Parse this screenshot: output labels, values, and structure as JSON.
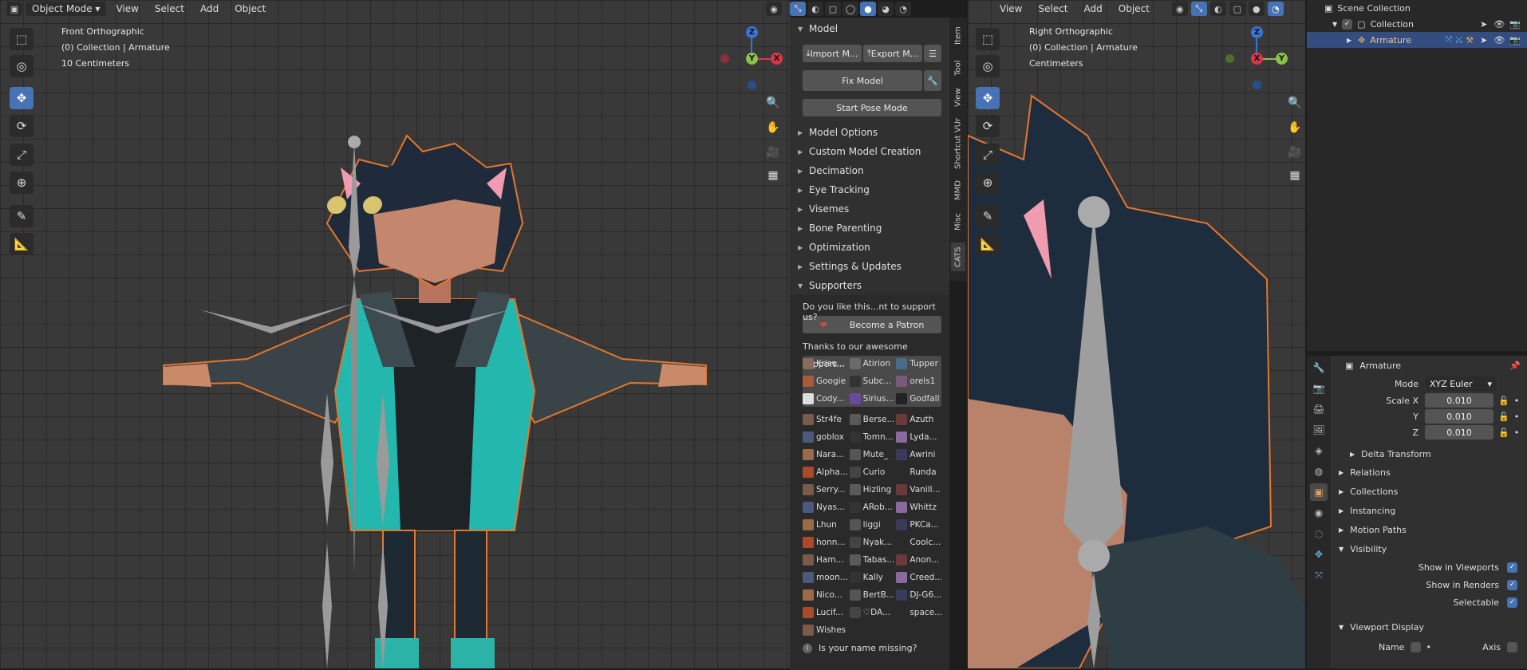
{
  "left_viewport": {
    "header": {
      "mode": "Object Mode",
      "menus": [
        "View",
        "Select",
        "Add",
        "Object"
      ]
    },
    "overlay": {
      "view": "Front Orthographic",
      "collection": "(0) Collection | Armature",
      "scale": "10 Centimeters"
    },
    "gizmo": {
      "z": "Z",
      "y": "Y",
      "x": "X"
    }
  },
  "npanel": {
    "model_header": "Model",
    "import_label": "Import M...",
    "export_label": "Export M...",
    "fix_model": "Fix Model",
    "start_pose": "Start Pose Mode",
    "sections": [
      "Model Options",
      "Custom Model Creation",
      "Decimation",
      "Eye Tracking",
      "Visemes",
      "Bone Parenting",
      "Optimization",
      "Settings & Updates"
    ],
    "supporters_header": "Supporters",
    "support_question": "Do you like this...nt to support us?",
    "patron_label": "Become a Patron",
    "thanks_text": "Thanks to our awesome support...",
    "top_supporters": [
      "Krisu...",
      "Atirion",
      "Tupper",
      "Googie",
      "Subc...",
      "orels1",
      "Cody...",
      "Sirius...",
      "Godfall"
    ],
    "supporters": [
      "Str4fe",
      "Berse...",
      "Azuth",
      "goblox",
      "Tomn...",
      "Lyda...",
      "Nara...",
      "Mute_",
      "Awrini",
      "Alpha...",
      "Curio",
      "Runda",
      "Serry...",
      "Hizling",
      "Vanill...",
      "Nyas...",
      "ARob...",
      "Whittz",
      "Lhun",
      "liggi",
      "PKCa...",
      "honn...",
      "Nyak...",
      "Coolc...",
      "Ham...",
      "Tabas...",
      "Anon...",
      "moon...",
      "Kally",
      "Creed...",
      "Nico...",
      "BertB...",
      "DJ-G6...",
      "Lucif...",
      "♡DA...",
      "space...",
      "Wishes"
    ],
    "name_missing": "Is your name missing?",
    "tabs": [
      "Item",
      "Tool",
      "View",
      "Shortcut VUr",
      "MMD",
      "Misc",
      "CATS"
    ]
  },
  "right_viewport": {
    "header": {
      "menus": [
        "View",
        "Select",
        "Add",
        "Object"
      ]
    },
    "overlay": {
      "view": "Right Orthographic",
      "collection": "(0) Collection | Armature",
      "scale": "Centimeters"
    },
    "gizmo": {
      "z": "Z",
      "y": "Y",
      "x": "X"
    }
  },
  "outliner": {
    "root": "Scene Collection",
    "collection": "Collection",
    "object": "Armature"
  },
  "properties": {
    "object_name": "Armature",
    "mode_label": "Mode",
    "mode_value": "XYZ Euler",
    "scale_label": "Scale X",
    "scale_x": "0.010",
    "y_label": "Y",
    "scale_y": "0.010",
    "z_label": "Z",
    "scale_z": "0.010",
    "delta": "Delta Transform",
    "sections": [
      "Relations",
      "Collections",
      "Instancing",
      "Motion Paths"
    ],
    "visibility": "Visibility",
    "show_viewports": "Show in Viewports",
    "show_renders": "Show in Renders",
    "selectable": "Selectable",
    "viewport_display": "Viewport Display",
    "name_label": "Name",
    "axis_label": "Axis"
  },
  "colors": {
    "accent": "#4772b3",
    "outline": "#e6762a",
    "bone": "#9a9a9a"
  }
}
